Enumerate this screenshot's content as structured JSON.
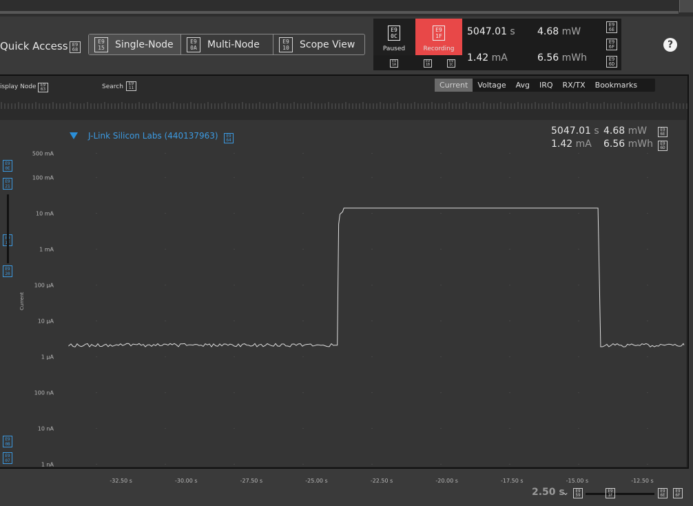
{
  "header": {
    "quick_access_label": "Quick Access",
    "quick_access_icon": [
      "E9",
      "68"
    ],
    "view_tabs": [
      {
        "label": "Single-Node",
        "icon": [
          "E9",
          "15"
        ],
        "active": true
      },
      {
        "label": "Multi-Node",
        "icon": [
          "E9",
          "0A"
        ],
        "active": false
      },
      {
        "label": "Scope View",
        "icon": [
          "E9",
          "10"
        ],
        "active": false
      }
    ],
    "help_glyph": "?"
  },
  "recording": {
    "paused_label": "Paused",
    "paused_icon": [
      "E9",
      "0C"
    ],
    "recording_label": "Recording",
    "recording_icon": [
      "E9",
      "1F"
    ],
    "recording_color": "#e84848",
    "small_icons": [
      [
        "E9",
        "1A"
      ],
      [
        "E9",
        "1B"
      ],
      [
        "E9",
        "1C"
      ]
    ],
    "time": {
      "value": "5047.01",
      "unit": "s"
    },
    "current": {
      "value": "1.42",
      "unit": "mA"
    },
    "power": {
      "value": "4.68",
      "unit": "mW"
    },
    "energy": {
      "value": "6.56",
      "unit": "mWh"
    },
    "side_icons": [
      [
        "E9",
        "6E"
      ],
      [
        "E9",
        "6F"
      ],
      [
        "E9",
        "6D"
      ]
    ]
  },
  "toolbar": {
    "display_node_label": "isplay Node",
    "display_node_icon": [
      "E9",
      "63"
    ],
    "search_label": "Search",
    "search_icon": [
      "E9",
      "11"
    ],
    "metric_tabs": [
      {
        "label": "Current",
        "active": true
      },
      {
        "label": "Voltage",
        "active": false
      },
      {
        "label": "Avg",
        "active": false
      },
      {
        "label": "IRQ",
        "active": false
      },
      {
        "label": "RX/TX",
        "active": false
      },
      {
        "label": "Bookmarks",
        "active": false
      }
    ]
  },
  "node": {
    "name": "J-Link Silicon Labs (440137963)",
    "icon": [
      "E9",
      "64"
    ],
    "accent_color": "#3c9be3",
    "time": {
      "value": "5047.01",
      "unit": "s"
    },
    "current": {
      "value": "1.42",
      "unit": "mA"
    },
    "power": {
      "value": "4.68",
      "unit": "mW"
    },
    "energy": {
      "value": "6.56",
      "unit": "mWh"
    },
    "side_icons": [
      [
        "E9",
        "6E"
      ],
      [
        "E9",
        "6D"
      ]
    ]
  },
  "left_icons": {
    "top": [
      [
        "E9",
        "0E"
      ],
      [
        "E9",
        "21"
      ]
    ],
    "mid": [
      [
        "E9",
        "1F"
      ],
      [
        "E9",
        "20"
      ]
    ],
    "bottom": [
      [
        "E9",
        "0B"
      ],
      [
        "E9",
        "07"
      ]
    ]
  },
  "chart_data": {
    "type": "line",
    "ylabel": "Current",
    "y_scale": "log",
    "y_ticks": [
      "500 mA",
      "100 mA",
      "10 mA",
      "1 mA",
      "100 µA",
      "10 µA",
      "1 µA",
      "100 nA",
      "10 nA",
      "1 nA"
    ],
    "x_ticks": [
      "-32.50 s",
      "-30.00 s",
      "-27.50 s",
      "-25.00 s",
      "-22.50 s",
      "-20.00 s",
      "-17.50 s",
      "-15.00 s",
      "-12.50 s"
    ],
    "xlim": [
      -34.5,
      -10.9
    ],
    "series": [
      {
        "color": "#e0e0e0",
        "points": [
          [
            -34.5,
            2.1e-06
          ],
          [
            -24.3,
            2.1e-06
          ],
          [
            -24.2,
            2.1e-06
          ],
          [
            -24.15,
            0.005
          ],
          [
            -24.1,
            0.0095
          ],
          [
            -24.0,
            0.011
          ],
          [
            -23.95,
            0.014
          ],
          [
            -20.0,
            0.014
          ],
          [
            -17.5,
            0.014
          ],
          [
            -14.3,
            0.014
          ],
          [
            -14.2,
            0.014
          ],
          [
            -14.1,
            2.1e-06
          ],
          [
            -10.9,
            2.1e-06
          ]
        ]
      }
    ]
  },
  "bottom": {
    "zoom_value": "2.50 s",
    "zoom_chevron": "⌄",
    "icons": [
      [
        "E9",
        "59"
      ],
      [
        "E9",
        "1F"
      ],
      [
        "E9",
        "6E"
      ],
      [
        "E9",
        "6F"
      ]
    ]
  }
}
